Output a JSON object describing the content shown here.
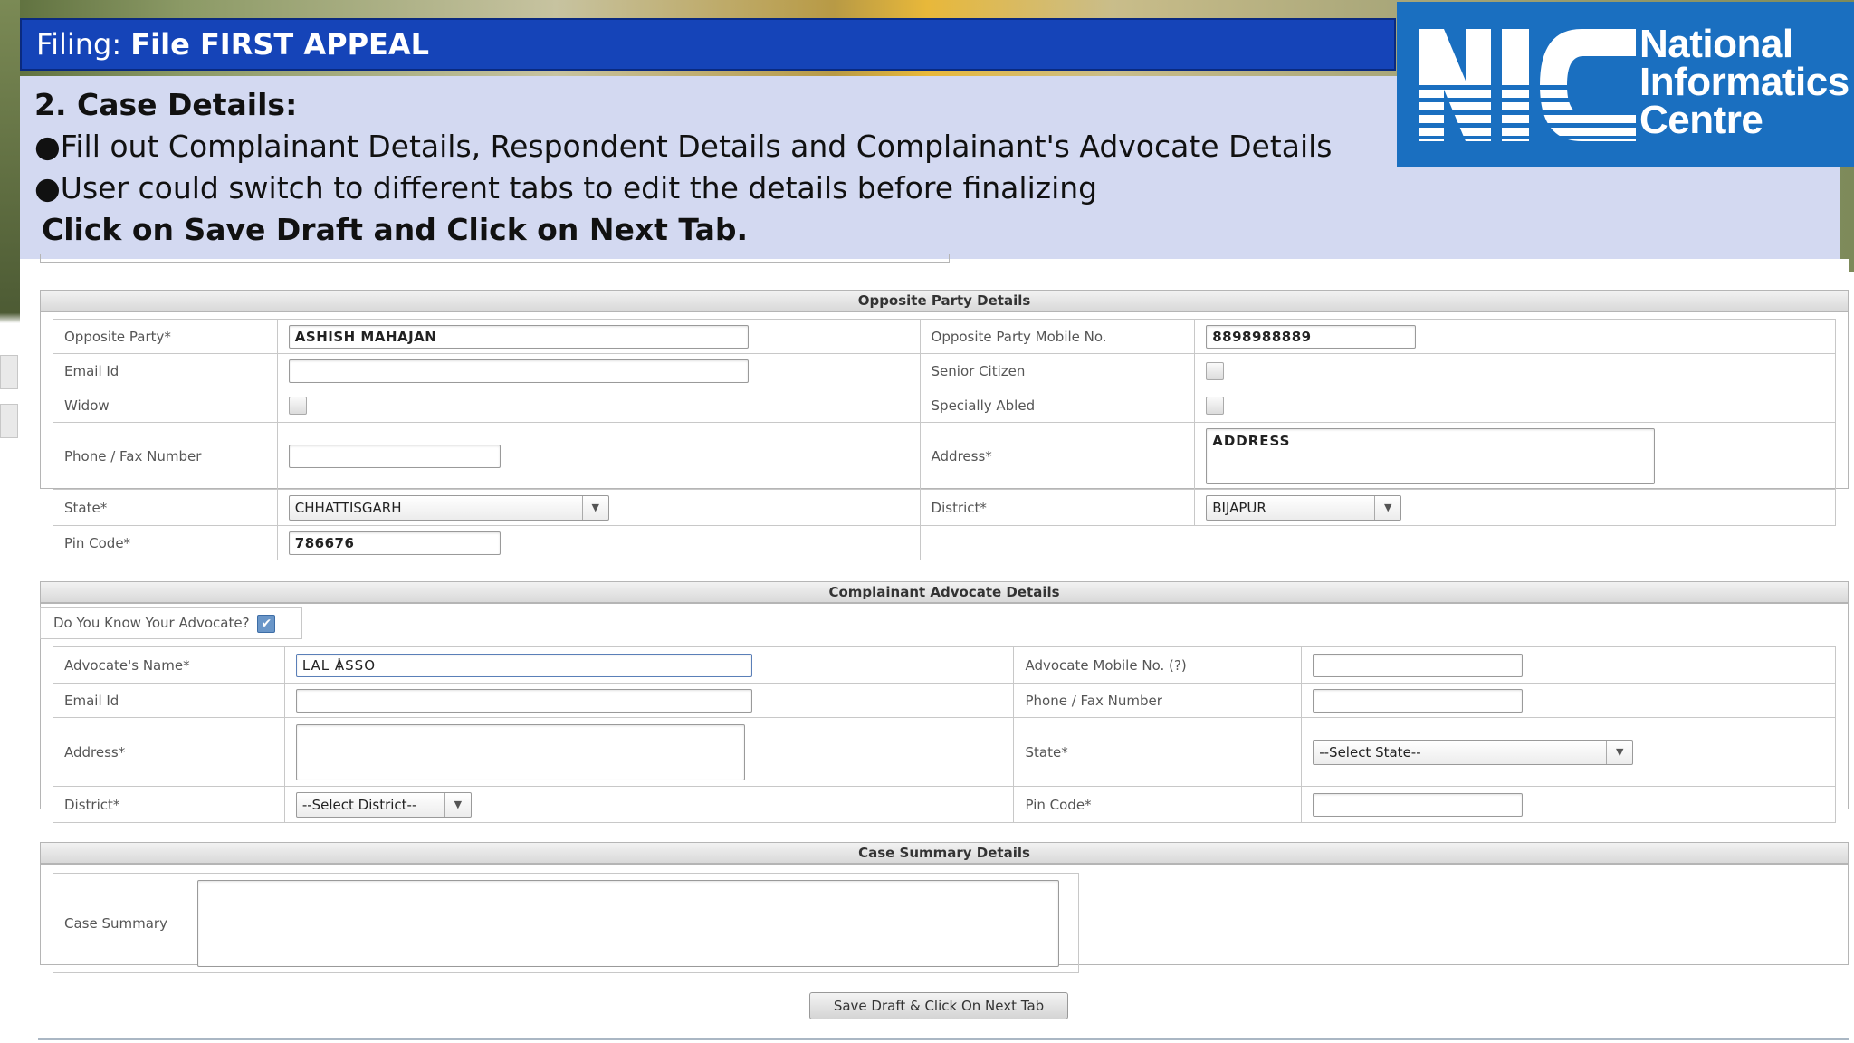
{
  "slide": {
    "title_prefix": "Filing:",
    "title_main": "File FIRST APPEAL",
    "heading": "2. Case Details:",
    "bullet1": "●Fill out Complainant Details, Respondent Details and Complainant's Advocate Details",
    "bullet2": "●User could switch to different tabs to edit the details before finalizing",
    "instruction": "Click on Save Draft and Click on Next Tab."
  },
  "logo": {
    "line1": "National",
    "line2": "Informatics",
    "line3": "Centre",
    "mark": "NIC"
  },
  "opposite_party": {
    "section_title": "Opposite Party Details",
    "labels": {
      "party": "Opposite Party*",
      "mobile": "Opposite Party Mobile No.",
      "email": "Email Id",
      "senior": "Senior Citizen",
      "widow": "Widow",
      "abled": "Specially Abled",
      "phone": "Phone / Fax Number",
      "address": "Address*",
      "state": "State*",
      "district": "District*",
      "pin": "Pin Code*"
    },
    "values": {
      "party": "ASHISH MAHAJAN",
      "mobile": "8898988889",
      "email": "",
      "phone": "",
      "address": "ADDRESS",
      "state": "CHHATTISGARH",
      "district": "BIJAPUR",
      "pin": "786676"
    }
  },
  "advocate": {
    "section_title": "Complainant Advocate Details",
    "know_label": "Do You Know Your Advocate?",
    "labels": {
      "name": "Advocate's Name*",
      "mobile": "Advocate Mobile No. (?)",
      "email": "Email Id",
      "phone": "Phone / Fax Number",
      "address": "Address*",
      "state": "State*",
      "district": "District*",
      "pin": "Pin Code*"
    },
    "values": {
      "name": "LAL ASSO",
      "mobile": "",
      "email": "",
      "phone": "",
      "address": "",
      "state": "--Select State--",
      "district": "--Select District--",
      "pin": ""
    }
  },
  "case_summary": {
    "section_title": "Case Summary Details",
    "label": "Case Summary",
    "value": ""
  },
  "actions": {
    "save_next": "Save Draft & Click On Next Tab"
  },
  "colors": {
    "title_bar": "#1544b8",
    "instruction_bg": "#d3d9f1",
    "logo_bg": "#1a6fc0"
  }
}
